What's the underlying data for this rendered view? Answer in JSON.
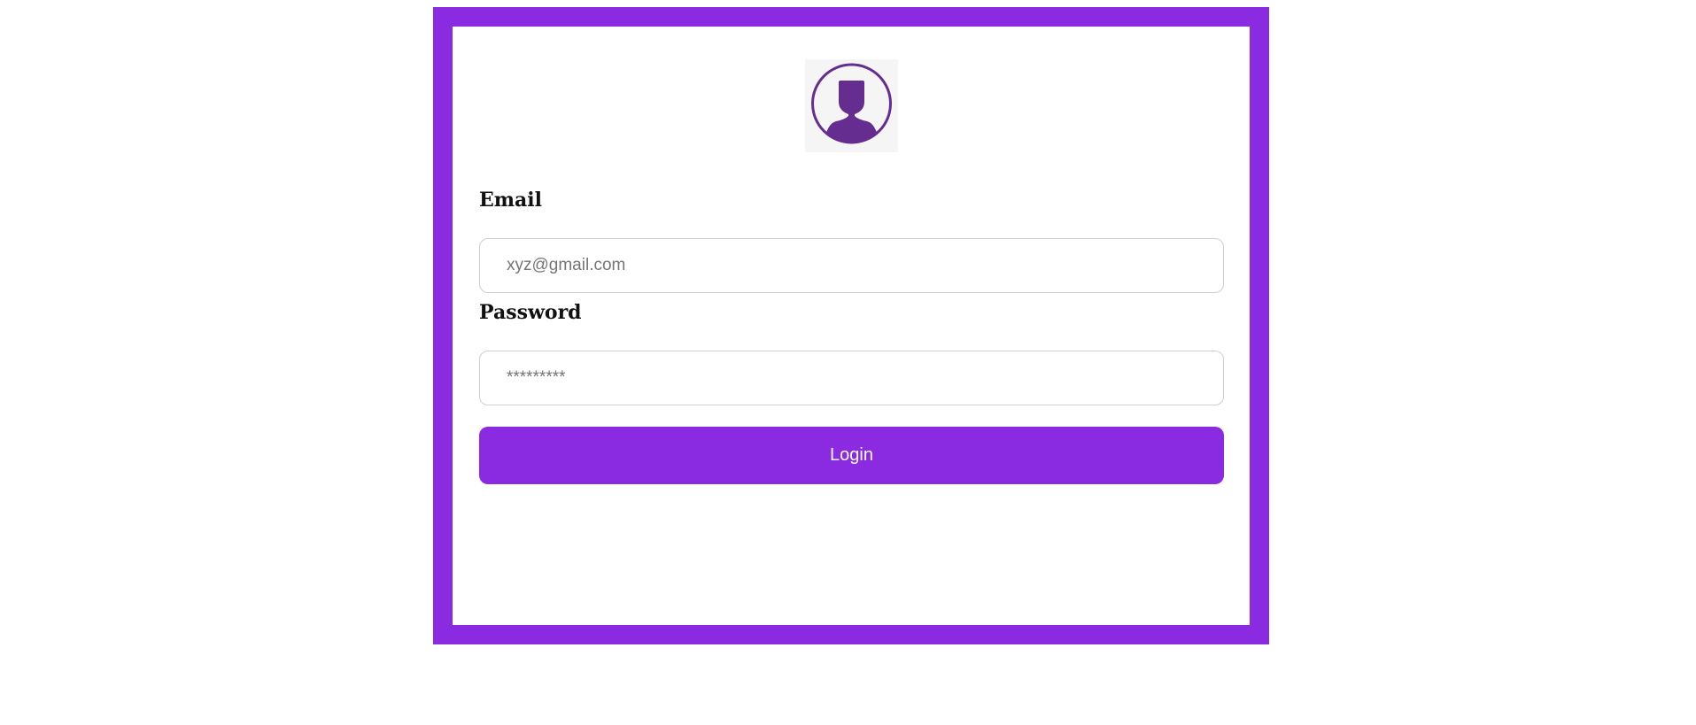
{
  "form": {
    "avatar_icon": "user-avatar-icon",
    "email_label": "Email",
    "email_placeholder": "xyz@gmail.com",
    "email_value": "",
    "password_label": "Password",
    "password_placeholder": "*********",
    "password_value": "",
    "login_label": "Login"
  },
  "colors": {
    "accent": "#8a2be2",
    "avatar": "#662d91",
    "background": "#ffffff"
  }
}
